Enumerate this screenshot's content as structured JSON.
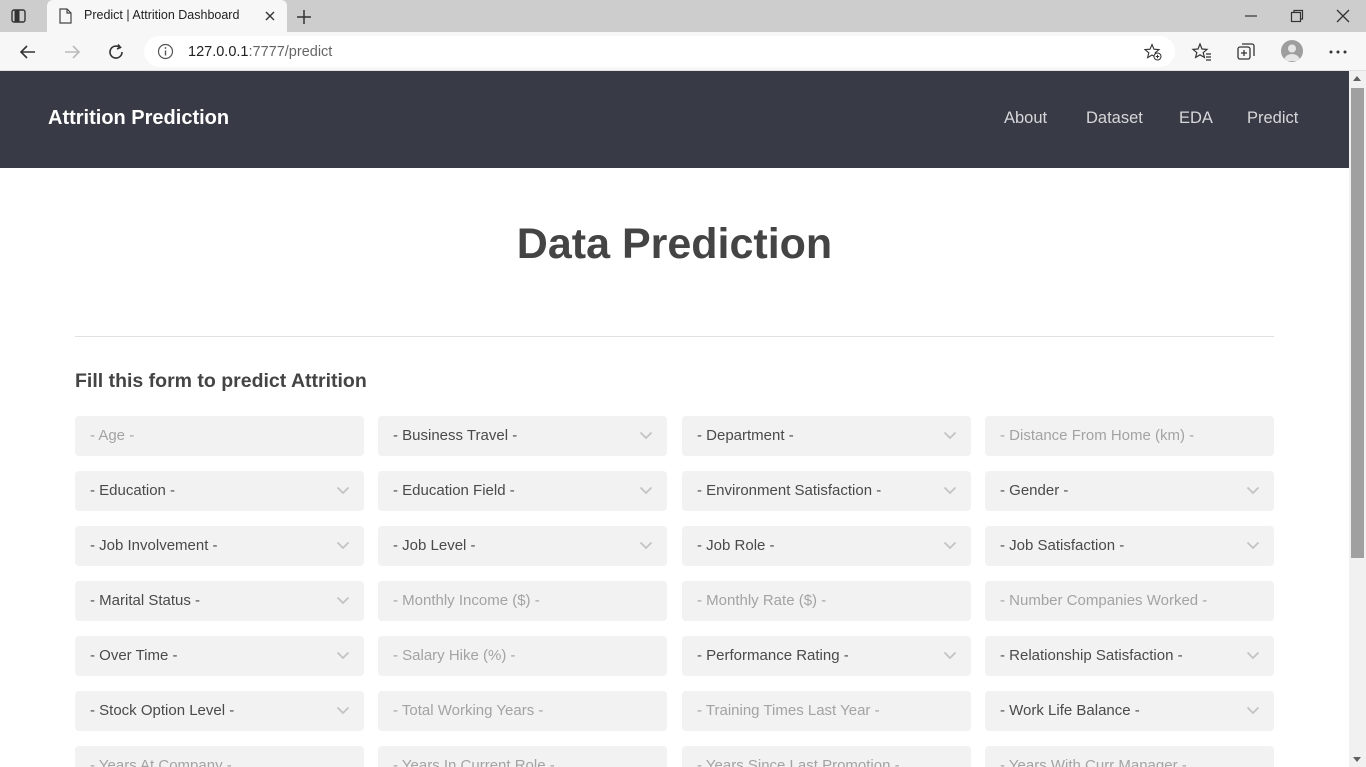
{
  "browser": {
    "tab_title": "Predict | Attrition Dashboard",
    "url_host": "127.0.0.1",
    "url_rest": ":7777/predict",
    "icons": [
      "tab-actions-icon",
      "page-favicon-icon",
      "close-icon",
      "plus-icon",
      "minimize-icon",
      "restore-icon",
      "close-window-icon",
      "back-arrow-icon",
      "forward-arrow-icon",
      "refresh-icon",
      "info-icon",
      "add-favorite-icon",
      "favorites-icon",
      "collections-icon",
      "profile-avatar-icon",
      "more-icon"
    ]
  },
  "site": {
    "brand": "Attrition Prediction",
    "nav": [
      "About",
      "Dataset",
      "EDA",
      "Predict"
    ],
    "nav_bg": "#383b45"
  },
  "page": {
    "title": "Data Prediction",
    "form_title": "Fill this form to predict Attrition"
  },
  "form": {
    "fields": [
      {
        "label": "- Age -",
        "type": "input"
      },
      {
        "label": "- Business Travel -",
        "type": "select"
      },
      {
        "label": "- Department -",
        "type": "select"
      },
      {
        "label": "- Distance From Home (km) -",
        "type": "input"
      },
      {
        "label": "- Education -",
        "type": "select"
      },
      {
        "label": "- Education Field -",
        "type": "select"
      },
      {
        "label": "- Environment Satisfaction -",
        "type": "select"
      },
      {
        "label": "- Gender -",
        "type": "select"
      },
      {
        "label": "- Job Involvement -",
        "type": "select"
      },
      {
        "label": "- Job Level -",
        "type": "select"
      },
      {
        "label": "- Job Role -",
        "type": "select"
      },
      {
        "label": "- Job Satisfaction -",
        "type": "select"
      },
      {
        "label": "- Marital Status -",
        "type": "select"
      },
      {
        "label": "- Monthly Income ($) -",
        "type": "input"
      },
      {
        "label": "- Monthly Rate ($) -",
        "type": "input"
      },
      {
        "label": "- Number Companies Worked -",
        "type": "input"
      },
      {
        "label": "- Over Time -",
        "type": "select"
      },
      {
        "label": "- Salary Hike (%) -",
        "type": "input"
      },
      {
        "label": "- Performance Rating -",
        "type": "select"
      },
      {
        "label": "- Relationship Satisfaction -",
        "type": "select"
      },
      {
        "label": "- Stock Option Level -",
        "type": "select"
      },
      {
        "label": "- Total Working Years -",
        "type": "input"
      },
      {
        "label": "- Training Times Last Year -",
        "type": "input"
      },
      {
        "label": "- Work Life Balance -",
        "type": "select"
      },
      {
        "label": "- Years At Company -",
        "type": "input"
      },
      {
        "label": "- Years In Current Role -",
        "type": "input"
      },
      {
        "label": "- Years Since Last Promotion -",
        "type": "input"
      },
      {
        "label": "- Years With Curr Manager -",
        "type": "input"
      }
    ]
  }
}
